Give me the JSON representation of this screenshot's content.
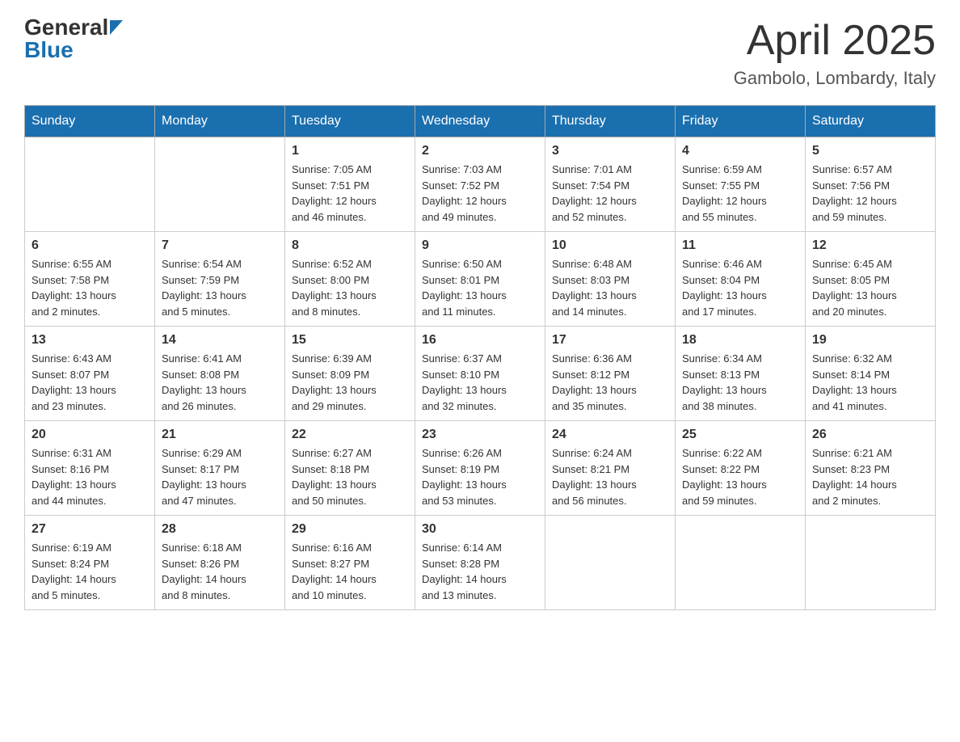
{
  "header": {
    "logo_general": "General",
    "logo_blue": "Blue",
    "title": "April 2025",
    "subtitle": "Gambolo, Lombardy, Italy"
  },
  "weekdays": [
    "Sunday",
    "Monday",
    "Tuesday",
    "Wednesday",
    "Thursday",
    "Friday",
    "Saturday"
  ],
  "weeks": [
    [
      {
        "day": "",
        "info": ""
      },
      {
        "day": "",
        "info": ""
      },
      {
        "day": "1",
        "info": "Sunrise: 7:05 AM\nSunset: 7:51 PM\nDaylight: 12 hours\nand 46 minutes."
      },
      {
        "day": "2",
        "info": "Sunrise: 7:03 AM\nSunset: 7:52 PM\nDaylight: 12 hours\nand 49 minutes."
      },
      {
        "day": "3",
        "info": "Sunrise: 7:01 AM\nSunset: 7:54 PM\nDaylight: 12 hours\nand 52 minutes."
      },
      {
        "day": "4",
        "info": "Sunrise: 6:59 AM\nSunset: 7:55 PM\nDaylight: 12 hours\nand 55 minutes."
      },
      {
        "day": "5",
        "info": "Sunrise: 6:57 AM\nSunset: 7:56 PM\nDaylight: 12 hours\nand 59 minutes."
      }
    ],
    [
      {
        "day": "6",
        "info": "Sunrise: 6:55 AM\nSunset: 7:58 PM\nDaylight: 13 hours\nand 2 minutes."
      },
      {
        "day": "7",
        "info": "Sunrise: 6:54 AM\nSunset: 7:59 PM\nDaylight: 13 hours\nand 5 minutes."
      },
      {
        "day": "8",
        "info": "Sunrise: 6:52 AM\nSunset: 8:00 PM\nDaylight: 13 hours\nand 8 minutes."
      },
      {
        "day": "9",
        "info": "Sunrise: 6:50 AM\nSunset: 8:01 PM\nDaylight: 13 hours\nand 11 minutes."
      },
      {
        "day": "10",
        "info": "Sunrise: 6:48 AM\nSunset: 8:03 PM\nDaylight: 13 hours\nand 14 minutes."
      },
      {
        "day": "11",
        "info": "Sunrise: 6:46 AM\nSunset: 8:04 PM\nDaylight: 13 hours\nand 17 minutes."
      },
      {
        "day": "12",
        "info": "Sunrise: 6:45 AM\nSunset: 8:05 PM\nDaylight: 13 hours\nand 20 minutes."
      }
    ],
    [
      {
        "day": "13",
        "info": "Sunrise: 6:43 AM\nSunset: 8:07 PM\nDaylight: 13 hours\nand 23 minutes."
      },
      {
        "day": "14",
        "info": "Sunrise: 6:41 AM\nSunset: 8:08 PM\nDaylight: 13 hours\nand 26 minutes."
      },
      {
        "day": "15",
        "info": "Sunrise: 6:39 AM\nSunset: 8:09 PM\nDaylight: 13 hours\nand 29 minutes."
      },
      {
        "day": "16",
        "info": "Sunrise: 6:37 AM\nSunset: 8:10 PM\nDaylight: 13 hours\nand 32 minutes."
      },
      {
        "day": "17",
        "info": "Sunrise: 6:36 AM\nSunset: 8:12 PM\nDaylight: 13 hours\nand 35 minutes."
      },
      {
        "day": "18",
        "info": "Sunrise: 6:34 AM\nSunset: 8:13 PM\nDaylight: 13 hours\nand 38 minutes."
      },
      {
        "day": "19",
        "info": "Sunrise: 6:32 AM\nSunset: 8:14 PM\nDaylight: 13 hours\nand 41 minutes."
      }
    ],
    [
      {
        "day": "20",
        "info": "Sunrise: 6:31 AM\nSunset: 8:16 PM\nDaylight: 13 hours\nand 44 minutes."
      },
      {
        "day": "21",
        "info": "Sunrise: 6:29 AM\nSunset: 8:17 PM\nDaylight: 13 hours\nand 47 minutes."
      },
      {
        "day": "22",
        "info": "Sunrise: 6:27 AM\nSunset: 8:18 PM\nDaylight: 13 hours\nand 50 minutes."
      },
      {
        "day": "23",
        "info": "Sunrise: 6:26 AM\nSunset: 8:19 PM\nDaylight: 13 hours\nand 53 minutes."
      },
      {
        "day": "24",
        "info": "Sunrise: 6:24 AM\nSunset: 8:21 PM\nDaylight: 13 hours\nand 56 minutes."
      },
      {
        "day": "25",
        "info": "Sunrise: 6:22 AM\nSunset: 8:22 PM\nDaylight: 13 hours\nand 59 minutes."
      },
      {
        "day": "26",
        "info": "Sunrise: 6:21 AM\nSunset: 8:23 PM\nDaylight: 14 hours\nand 2 minutes."
      }
    ],
    [
      {
        "day": "27",
        "info": "Sunrise: 6:19 AM\nSunset: 8:24 PM\nDaylight: 14 hours\nand 5 minutes."
      },
      {
        "day": "28",
        "info": "Sunrise: 6:18 AM\nSunset: 8:26 PM\nDaylight: 14 hours\nand 8 minutes."
      },
      {
        "day": "29",
        "info": "Sunrise: 6:16 AM\nSunset: 8:27 PM\nDaylight: 14 hours\nand 10 minutes."
      },
      {
        "day": "30",
        "info": "Sunrise: 6:14 AM\nSunset: 8:28 PM\nDaylight: 14 hours\nand 13 minutes."
      },
      {
        "day": "",
        "info": ""
      },
      {
        "day": "",
        "info": ""
      },
      {
        "day": "",
        "info": ""
      }
    ]
  ]
}
